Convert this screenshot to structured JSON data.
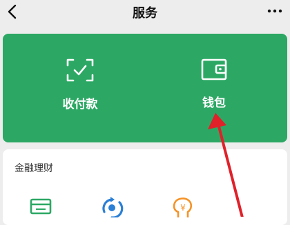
{
  "header": {
    "title": "服务"
  },
  "actions": [
    {
      "label": "收付款"
    },
    {
      "label": "钱包"
    }
  ],
  "finance": {
    "title": "金融理财"
  },
  "colors": {
    "green": "#2ca864",
    "arrow": "#e0212a",
    "background": "#ededed"
  }
}
